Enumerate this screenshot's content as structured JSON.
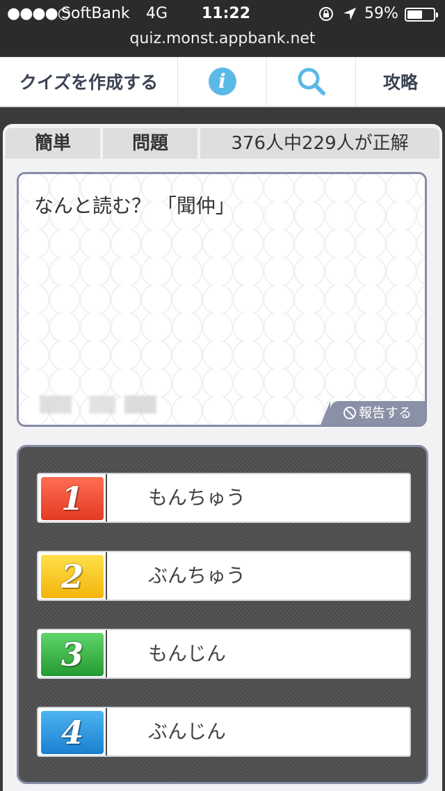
{
  "status_bar": {
    "signal": "●●●●○",
    "carrier": "SoftBank",
    "network": "4G",
    "time": "11:22",
    "battery": "59%",
    "battery_level": 0.59
  },
  "browser": {
    "url": "quiz.monst.appbank.net"
  },
  "nav": {
    "create_label": "クイズを作成する",
    "info_label": "i",
    "guide_label": "攻略"
  },
  "quiz_meta": {
    "difficulty": "簡単",
    "type": "問題",
    "stats": "376人中229人が正解"
  },
  "question": {
    "text": "なんと読む？ 「聞仲」",
    "report_label": "報告する"
  },
  "choices": [
    {
      "number": "1",
      "label": "もんちゅう",
      "color_top": "#ff6e54",
      "color_bottom": "#e43a22"
    },
    {
      "number": "2",
      "label": "ぶんちゅう",
      "color_top": "#ffe04a",
      "color_bottom": "#f3b40c"
    },
    {
      "number": "3",
      "label": "もんじん",
      "color_top": "#5fd46a",
      "color_bottom": "#249a32"
    },
    {
      "number": "4",
      "label": "ぶんじん",
      "color_top": "#4db4f2",
      "color_bottom": "#1a7fd0"
    }
  ]
}
